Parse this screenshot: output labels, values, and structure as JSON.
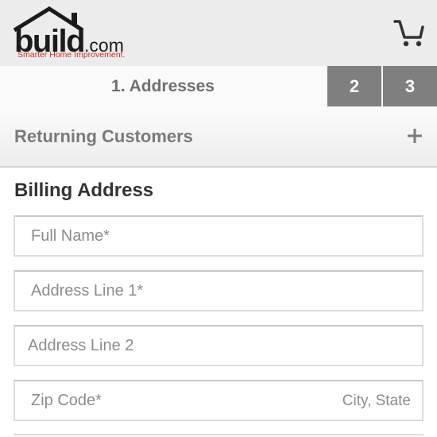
{
  "header": {
    "logo_main": "build",
    "logo_suffix": ".com",
    "logo_tagline": "Smarter Home Improvement.",
    "cart_icon": "shopping-cart-icon"
  },
  "steps": {
    "active_label": "1. Addresses",
    "step2_label": "2",
    "step3_label": "3"
  },
  "returning": {
    "label": "Returning Customers",
    "expand_icon": "plus-icon"
  },
  "billing": {
    "title": "Billing Address",
    "full_name_placeholder": "Full Name*",
    "address1_placeholder": "Address Line 1*",
    "address2_placeholder": "Address Line 2",
    "zip_placeholder": "Zip Code*",
    "city_state_placeholder": "City, State"
  },
  "colors": {
    "header_bg": "#ececec",
    "step_inactive_bg": "#7f7f7f",
    "tagline_red": "#c8312a",
    "placeholder_gray": "#8c8c8c"
  }
}
